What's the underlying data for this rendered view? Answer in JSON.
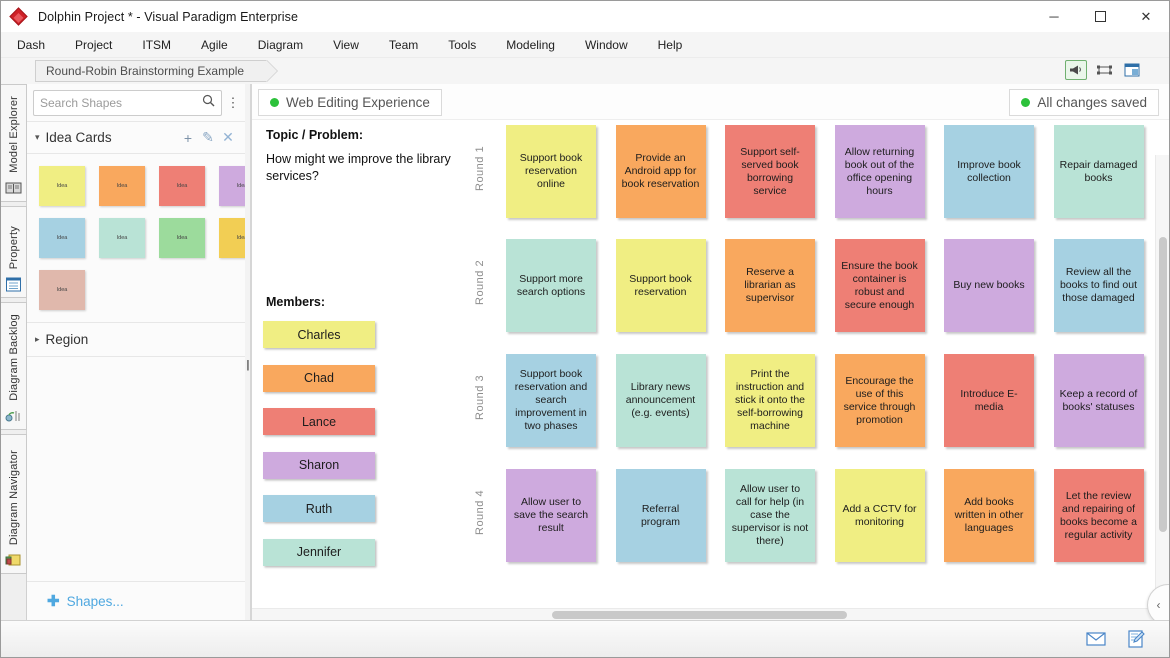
{
  "window": {
    "title": "Dolphin Project * - Visual Paradigm Enterprise",
    "app_icon": "diamond-logo-icon",
    "minimize": "─",
    "maximize": "☐",
    "close": "✕"
  },
  "menubar": {
    "items": [
      {
        "label": "Dash"
      },
      {
        "label": "Project"
      },
      {
        "label": "ITSM"
      },
      {
        "label": "Agile"
      },
      {
        "label": "Diagram"
      },
      {
        "label": "View"
      },
      {
        "label": "Team"
      },
      {
        "label": "Tools"
      },
      {
        "label": "Modeling"
      },
      {
        "label": "Window"
      },
      {
        "label": "Help"
      }
    ]
  },
  "tabstrip": {
    "document_tab": "Round-Robin Brainstorming Example",
    "tools": [
      {
        "name": "announcement-icon",
        "glyph": "📣",
        "selected": true
      },
      {
        "name": "fit-to-window-icon",
        "glyph": "⬚",
        "selected": false
      },
      {
        "name": "panel-layout-icon",
        "glyph": "▤",
        "selected": false
      }
    ]
  },
  "vdock": {
    "tabs": [
      {
        "label": "Model Explorer",
        "icon": "book-icon"
      },
      {
        "label": "Property",
        "icon": "property-grid-icon"
      },
      {
        "label": "Diagram Backlog",
        "icon": "backlog-icon"
      },
      {
        "label": "Diagram Navigator",
        "icon": "diagram-navigator-icon"
      }
    ]
  },
  "shapes_panel": {
    "search": {
      "placeholder": "Search Shapes",
      "value": "",
      "icon": "search-icon",
      "menu_icon": "kebab-menu-icon"
    },
    "idea_cards": {
      "title": "Idea Cards",
      "caret": "▾",
      "actions": [
        {
          "name": "add-idea-card-button",
          "glyph": "+"
        },
        {
          "name": "edit-idea-card-button",
          "glyph": "✎"
        },
        {
          "name": "remove-idea-card-button",
          "glyph": "✕"
        }
      ],
      "swatch_label": "Idea",
      "swatches": [
        {
          "color": "#f0ee83"
        },
        {
          "color": "#f9a85e"
        },
        {
          "color": "#ee7f75"
        },
        {
          "color": "#ceaade"
        },
        {
          "color": "#a6d1e2"
        },
        {
          "color": "#b9e3d6"
        },
        {
          "color": "#9cdb9c"
        },
        {
          "color": "#f2ce54"
        },
        {
          "color": "#e0b8ac"
        }
      ]
    },
    "region": {
      "title": "Region",
      "caret": "▸"
    },
    "footer": {
      "plus": "✚",
      "label": "Shapes..."
    }
  },
  "canvas": {
    "web_editing_badge": {
      "label": "Web Editing Experience",
      "dot_color": "#2cc13b"
    },
    "saved_badge": {
      "label": "All changes saved",
      "dot_color": "#2cc13b"
    },
    "topic_label": "Topic / Problem:",
    "topic_text": "How might we improve the library services?",
    "members_label": "Members:",
    "members": [
      {
        "name": "Charles",
        "color": "#f0ee83"
      },
      {
        "name": "Chad",
        "color": "#f9a85e"
      },
      {
        "name": "Lance",
        "color": "#ee7f75"
      },
      {
        "name": "Sharon",
        "color": "#ceaade"
      },
      {
        "name": "Ruth",
        "color": "#a6d1e2"
      },
      {
        "name": "Jennifer",
        "color": "#b9e3d6"
      }
    ],
    "rounds": [
      {
        "label": "Round 1",
        "notes": [
          {
            "text": "Support book reservation online",
            "color": "#f0ee83"
          },
          {
            "text": "Provide an Android app for book reservation",
            "color": "#f9a85e"
          },
          {
            "text": "Support self-served book borrowing service",
            "color": "#ee7f75"
          },
          {
            "text": "Allow returning book out of the office opening hours",
            "color": "#ceaade"
          },
          {
            "text": "Improve book collection",
            "color": "#a6d1e2"
          },
          {
            "text": "Repair damaged books",
            "color": "#b9e3d6"
          }
        ]
      },
      {
        "label": "Round 2",
        "notes": [
          {
            "text": "Support more search options",
            "color": "#b9e3d6"
          },
          {
            "text": "Support book reservation",
            "color": "#f0ee83"
          },
          {
            "text": "Reserve a librarian as supervisor",
            "color": "#f9a85e"
          },
          {
            "text": "Ensure the book container is robust and secure enough",
            "color": "#ee7f75"
          },
          {
            "text": "Buy new books",
            "color": "#ceaade"
          },
          {
            "text": "Review all the books to find out those damaged",
            "color": "#a6d1e2"
          }
        ]
      },
      {
        "label": "Round 3",
        "notes": [
          {
            "text": "Support book reservation and search improvement in two phases",
            "color": "#a6d1e2"
          },
          {
            "text": "Library news announcement (e.g. events)",
            "color": "#b9e3d6"
          },
          {
            "text": "Print the instruction and stick it onto the self-borrowing machine",
            "color": "#f0ee83"
          },
          {
            "text": "Encourage the use of this service through promotion",
            "color": "#f9a85e"
          },
          {
            "text": "Introduce E-media",
            "color": "#ee7f75"
          },
          {
            "text": "Keep a record of books' statuses",
            "color": "#ceaade"
          }
        ]
      },
      {
        "label": "Round 4",
        "notes": [
          {
            "text": "Allow user to save the search result",
            "color": "#ceaade"
          },
          {
            "text": "Referral program",
            "color": "#a6d1e2"
          },
          {
            "text": "Allow user to call for help (in case the supervisor is not there)",
            "color": "#b9e3d6"
          },
          {
            "text": "Add a CCTV for monitoring",
            "color": "#f0ee83"
          },
          {
            "text": "Add books written in other languages",
            "color": "#f9a85e"
          },
          {
            "text": "Let the review and repairing of books become a regular activity",
            "color": "#ee7f75"
          }
        ]
      }
    ],
    "collapse_tab": "‹"
  },
  "statusbar": {
    "icons": [
      {
        "name": "mail-icon",
        "glyph": "✉"
      },
      {
        "name": "note-edit-icon",
        "glyph": "📝"
      }
    ]
  }
}
